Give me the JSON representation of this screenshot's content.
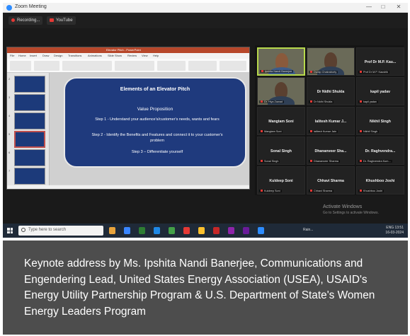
{
  "window": {
    "title": "Zoom Meeting",
    "controls": [
      "—",
      "□",
      "✕"
    ]
  },
  "meeting_bar": {
    "recording_label": "Recording...",
    "youtube_label": "YouTube"
  },
  "ppt": {
    "window_title": "Elevator Pitch - PowerPoint",
    "menu": [
      "File",
      "Home",
      "Insert",
      "Draw",
      "Design",
      "Transitions",
      "Animations",
      "Slide Show",
      "Review",
      "View",
      "Help"
    ],
    "thumb_numbers": [
      "2",
      "3",
      "4",
      "5",
      "6",
      "7"
    ],
    "selected_thumb_index": 3,
    "slide": {
      "title": "Elements of an Elevator Pitch",
      "subtitle": "Value Proposition",
      "step1": "Step 1 - Understand your audience's/customer's needs, wants and fears",
      "step2": "Step 2 - Identify the Benefits and Features and connect it to your customer's problem",
      "step3": "Step 3 – Differentiate yourself"
    }
  },
  "participants": [
    {
      "name": "",
      "label": "Ipshita Nandi Banerjee",
      "video": true,
      "active": true
    },
    {
      "name": "",
      "label": "Dwaip Chakraborty",
      "video": true,
      "active": false
    },
    {
      "name": "Prof Dr M.P. Kau...",
      "label": "Prof Dr M.P. Kaushik",
      "video": false,
      "active": false
    },
    {
      "name": "",
      "label": "Dr. Hiya Zawad",
      "video": true,
      "active": false
    },
    {
      "name": "Dr Nidhi Shukla",
      "label": "Dr Nidhi Shukla",
      "video": false,
      "active": false
    },
    {
      "name": "kapil yadav",
      "label": "kapil yadav",
      "video": false,
      "active": false
    },
    {
      "name": "Mangtam Soni",
      "label": "Mangtam Soni",
      "video": false,
      "active": false
    },
    {
      "name": "lalitesh Kumar J...",
      "label": "lalitesh Kumar Jain",
      "video": false,
      "active": false
    },
    {
      "name": "Nikhil Singh",
      "label": "Nikhil Singh",
      "video": false,
      "active": false
    },
    {
      "name": "Sonal Singh",
      "label": "Sonal Singh",
      "video": false,
      "active": false
    },
    {
      "name": "Dhananveer Sha...",
      "label": "Dhananveer Sharma",
      "video": false,
      "active": false
    },
    {
      "name": "Dr. Raghvendra...",
      "label": "Dr. Raghvendra Kum...",
      "video": false,
      "active": false
    },
    {
      "name": "Kuldeep Soni",
      "label": "Kuldeep Soni",
      "video": false,
      "active": false
    },
    {
      "name": "Chhavi Sharma",
      "label": "Chhavi Sharma",
      "video": false,
      "active": false
    },
    {
      "name": "Khushboo Joshi",
      "label": "Khushboo Joshi",
      "video": false,
      "active": false
    }
  ],
  "activate_windows": {
    "line1": "Activate Windows",
    "line2": "Go to Settings to activate Windows."
  },
  "taskbar": {
    "search_placeholder": "Type here to search",
    "tray_misc": "Rain...",
    "language": "ENG",
    "time": "13:51",
    "date": "16-03-2024",
    "app_icon_colors": [
      "#e8a33b",
      "#3a86ff",
      "#2e7d32",
      "#1e88e5",
      "#43a047",
      "#e53935",
      "#fbc02d",
      "#c62828",
      "#8e24aa",
      "#6a1b9a",
      "#2d8cff"
    ]
  },
  "caption": {
    "text": "Keynote address by Ms. Ipshita Nandi Banerjee, Communications and Engendering Lead, United States Energy Association (USEA), USAID's Energy Utility Partnership Program & U.S. Department of State's Women Energy Leaders Program"
  }
}
